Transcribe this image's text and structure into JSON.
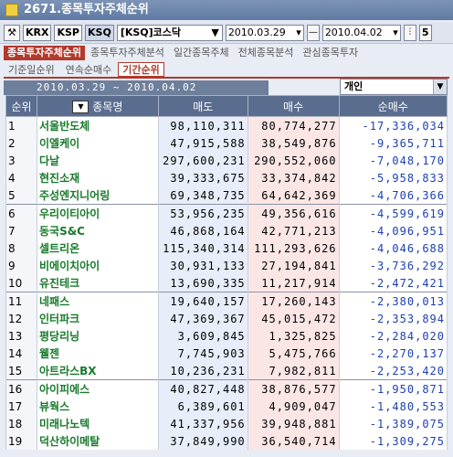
{
  "window": {
    "title": "2671.종목투자주체순위"
  },
  "toolbar": {
    "buttons": [
      "KRX",
      "KSP",
      "KSQ"
    ],
    "market_value": "[KSQ]코스닥",
    "date_from": "2010.03.29",
    "date_to": "2010.04.02",
    "right_label": "5"
  },
  "tabs_top": [
    "종목투자주체순위",
    "종목투자주체분석",
    "일간종목주체",
    "전체종목분석",
    "관심종목투자"
  ],
  "tabs_sub": [
    "기준일순위",
    "연속순매수",
    "기간순위"
  ],
  "period_label": "2010.03.29 ~ 2010.04.02",
  "investor_select": "개인",
  "table": {
    "headers": [
      "순위",
      "종목명",
      "매도",
      "매수",
      "순매수"
    ],
    "rows": [
      {
        "rank": "1",
        "name": "서울반도체",
        "sell": "98,110,311",
        "buy": "80,774,277",
        "net": "-17,336,034"
      },
      {
        "rank": "2",
        "name": "이엘케이",
        "sell": "47,915,588",
        "buy": "38,549,876",
        "net": "-9,365,711"
      },
      {
        "rank": "3",
        "name": "다날",
        "sell": "297,600,231",
        "buy": "290,552,060",
        "net": "-7,048,170"
      },
      {
        "rank": "4",
        "name": "현진소재",
        "sell": "39,333,675",
        "buy": "33,374,842",
        "net": "-5,958,833"
      },
      {
        "rank": "5",
        "name": "주성엔지니어링",
        "sell": "69,348,735",
        "buy": "64,642,369",
        "net": "-4,706,366"
      },
      {
        "rank": "6",
        "name": "우리이티아이",
        "sell": "53,956,235",
        "buy": "49,356,616",
        "net": "-4,599,619"
      },
      {
        "rank": "7",
        "name": "동국S&C",
        "sell": "46,868,164",
        "buy": "42,771,213",
        "net": "-4,096,951"
      },
      {
        "rank": "8",
        "name": "셀트리온",
        "sell": "115,340,314",
        "buy": "111,293,626",
        "net": "-4,046,688"
      },
      {
        "rank": "9",
        "name": "비에이치아이",
        "sell": "30,931,133",
        "buy": "27,194,841",
        "net": "-3,736,292"
      },
      {
        "rank": "10",
        "name": "유진테크",
        "sell": "13,690,335",
        "buy": "11,217,914",
        "net": "-2,472,421"
      },
      {
        "rank": "11",
        "name": "네패스",
        "sell": "19,640,157",
        "buy": "17,260,143",
        "net": "-2,380,013"
      },
      {
        "rank": "12",
        "name": "인터파크",
        "sell": "47,369,367",
        "buy": "45,015,472",
        "net": "-2,353,894"
      },
      {
        "rank": "13",
        "name": "평당리닝",
        "sell": "3,609,845",
        "buy": "1,325,825",
        "net": "-2,284,020"
      },
      {
        "rank": "14",
        "name": "웰젠",
        "sell": "7,745,903",
        "buy": "5,475,766",
        "net": "-2,270,137"
      },
      {
        "rank": "15",
        "name": "아트라스BX",
        "sell": "10,236,231",
        "buy": "7,982,811",
        "net": "-2,253,420"
      },
      {
        "rank": "16",
        "name": "아이피에스",
        "sell": "40,827,448",
        "buy": "38,876,577",
        "net": "-1,950,871"
      },
      {
        "rank": "17",
        "name": "뷰웍스",
        "sell": "6,389,601",
        "buy": "4,909,047",
        "net": "-1,480,553"
      },
      {
        "rank": "18",
        "name": "미래나노텍",
        "sell": "41,337,956",
        "buy": "39,948,881",
        "net": "-1,389,075"
      },
      {
        "rank": "19",
        "name": "덕산하이메탈",
        "sell": "37,849,990",
        "buy": "36,540,714",
        "net": "-1,309,275"
      }
    ]
  }
}
